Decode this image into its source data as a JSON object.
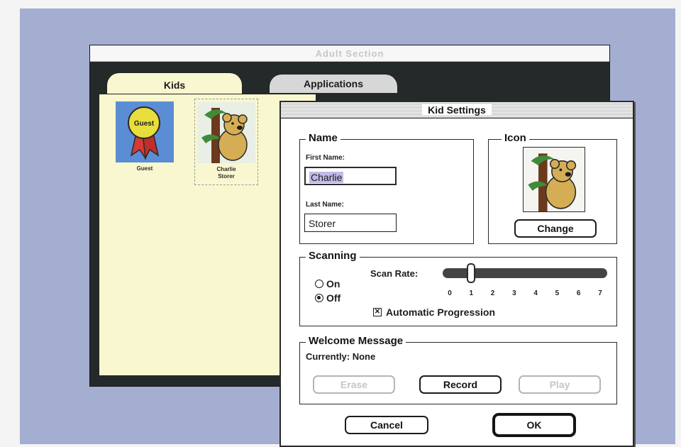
{
  "adult_window": {
    "title": "Adult Section",
    "tabs": [
      "Kids",
      "Applications"
    ]
  },
  "kids": [
    {
      "name": "Guest",
      "badge": "Guest",
      "icon": "ribbon-badge-icon"
    },
    {
      "name_line1": "Charlie",
      "name_line2": "Storer",
      "icon": "koala-icon"
    }
  ],
  "dialog": {
    "title": "Kid Settings",
    "name_group": {
      "label": "Name",
      "first_name_label": "First Name:",
      "first_name_value": "Charlie",
      "last_name_label": "Last Name:",
      "last_name_value": "Storer"
    },
    "icon_group": {
      "label": "Icon",
      "change_button": "Change",
      "icon": "koala-icon"
    },
    "scanning_group": {
      "label": "Scanning",
      "on_label": "On",
      "off_label": "Off",
      "selected": "Off",
      "scan_rate_label": "Scan Rate:",
      "scan_rate_value": 1,
      "scan_rate_ticks": [
        "0",
        "1",
        "2",
        "3",
        "4",
        "5",
        "6",
        "7"
      ],
      "auto_progression_label": "Automatic Progression",
      "auto_progression_checked": true
    },
    "welcome_group": {
      "label": "Welcome Message",
      "currently_text": "Currently: None",
      "erase_button": "Erase",
      "record_button": "Record",
      "play_button": "Play"
    },
    "cancel_button": "Cancel",
    "ok_button": "OK"
  },
  "colors": {
    "desktop": "#a3aed0",
    "kids_panel": "#f9f7cf",
    "selection": "#c3b9e8",
    "guest_tile": "#5b8dd4"
  }
}
